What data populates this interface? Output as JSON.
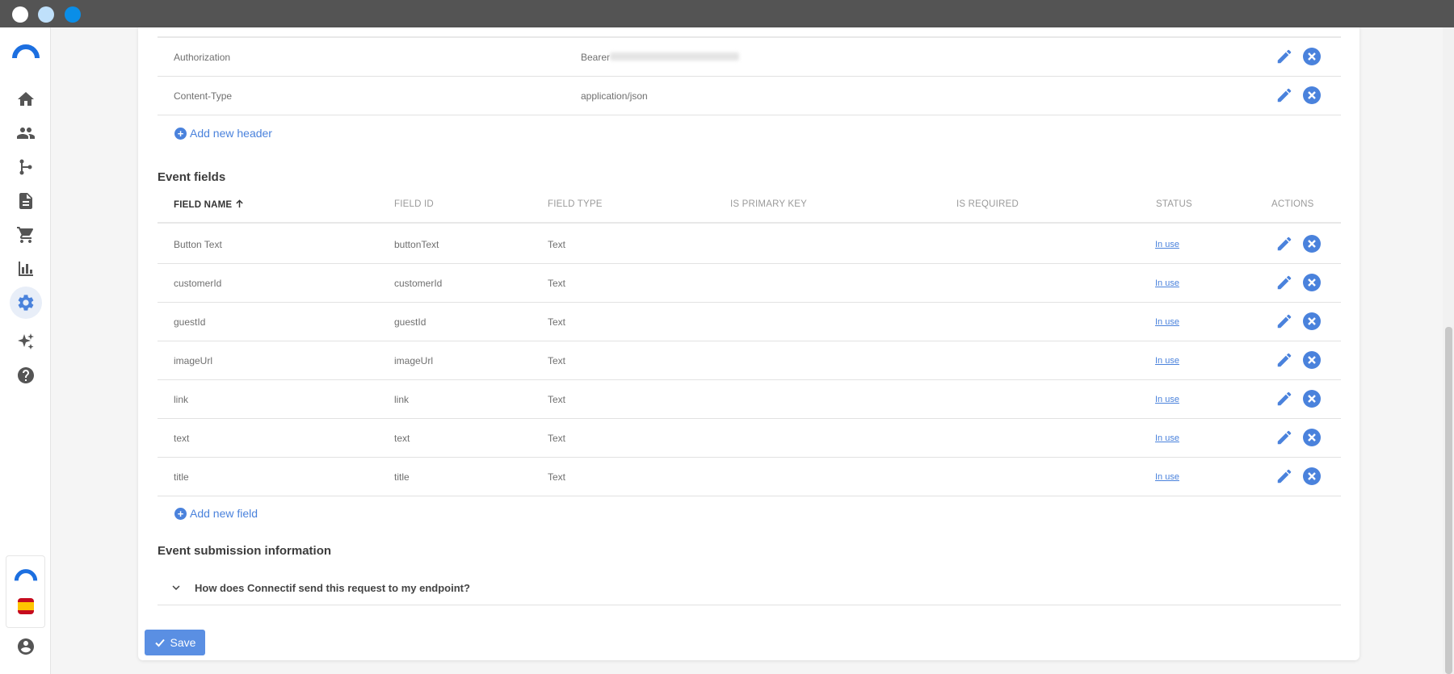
{
  "window": {
    "buttons": [
      "close",
      "minimize",
      "maximize"
    ]
  },
  "sidebar": {
    "logo": "connectif-logo",
    "items": [
      {
        "icon": "home-icon"
      },
      {
        "icon": "people-icon"
      },
      {
        "icon": "workflow-icon"
      },
      {
        "icon": "document-icon"
      },
      {
        "icon": "cart-icon"
      },
      {
        "icon": "bar-chart-icon"
      },
      {
        "icon": "gear-icon",
        "active": true
      },
      {
        "icon": "sparkles-icon"
      },
      {
        "icon": "help-icon"
      }
    ],
    "bottom": [
      {
        "icon": "connectif-logo-small"
      },
      {
        "icon": "spain-flag-icon"
      },
      {
        "icon": "account-icon"
      }
    ]
  },
  "headers_table": {
    "rows": [
      {
        "name": "Authorization",
        "value": "Bearer"
      },
      {
        "name": "Content-Type",
        "value": "application/json"
      }
    ],
    "add_label": "Add new header"
  },
  "event_fields": {
    "title": "Event fields",
    "columns": {
      "field_name": "FIELD NAME",
      "field_id": "FIELD ID",
      "field_type": "FIELD TYPE",
      "is_primary_key": "IS PRIMARY KEY",
      "is_required": "IS REQUIRED",
      "status": "STATUS",
      "actions": "ACTIONS"
    },
    "rows": [
      {
        "name": "Button Text",
        "id": "buttonText",
        "type": "Text",
        "status": "In use"
      },
      {
        "name": "customerId",
        "id": "customerId",
        "type": "Text",
        "status": "In use"
      },
      {
        "name": "guestId",
        "id": "guestId",
        "type": "Text",
        "status": "In use"
      },
      {
        "name": "imageUrl",
        "id": "imageUrl",
        "type": "Text",
        "status": "In use"
      },
      {
        "name": "link",
        "id": "link",
        "type": "Text",
        "status": "In use"
      },
      {
        "name": "text",
        "id": "text",
        "type": "Text",
        "status": "In use"
      },
      {
        "name": "title",
        "id": "title",
        "type": "Text",
        "status": "In use"
      }
    ],
    "add_label": "Add new field"
  },
  "submission": {
    "title": "Event submission information",
    "accordion_label": "How does Connectif send this request to my endpoint?"
  },
  "save_label": "Save",
  "colors": {
    "accent": "#4a82dc",
    "button": "#5a8fe3",
    "titlebar": "#545454"
  }
}
